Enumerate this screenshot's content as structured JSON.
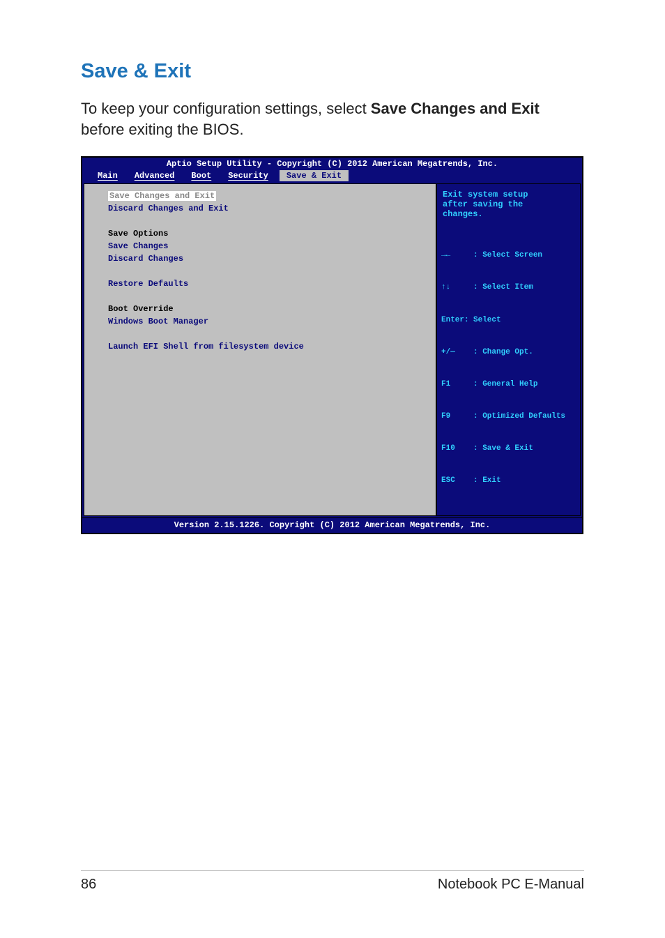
{
  "heading": "Save & Exit",
  "intro_before": "To keep your configuration settings, select ",
  "intro_bold": "Save Changes and Exit",
  "intro_after": " before exiting the BIOS.",
  "bios": {
    "title": "Aptio Setup Utility - Copyright (C) 2012 American Megatrends, Inc.",
    "tabs": {
      "main": "Main",
      "advanced": "Advanced",
      "boot": "Boot",
      "security": "Security",
      "save_exit": "Save & Exit"
    },
    "left": {
      "save_changes_exit": "Save Changes and Exit",
      "discard_changes_exit": "Discard Changes and Exit",
      "save_options_heading": "Save Options",
      "save_changes": "Save Changes",
      "discard_changes": "Discard Changes",
      "restore_defaults": "Restore Defaults",
      "boot_override_heading": "Boot Override",
      "windows_boot_manager": "Windows Boot Manager",
      "launch_efi_shell": "Launch EFI Shell from filesystem device"
    },
    "right": {
      "help_line1": "Exit system setup",
      "help_line2": "after saving the",
      "help_line3": "changes.",
      "keys": {
        "arrows_lr": "→←",
        "arrows_lr_desc": ": Select Screen",
        "arrows_ud": "↑↓",
        "arrows_ud_desc": ": Select Item",
        "enter": "Enter:",
        "enter_desc": "Select",
        "pm": "+/—",
        "pm_desc": ": Change Opt.",
        "f1": "F1",
        "f1_desc": ": General Help",
        "f9": "F9",
        "f9_desc": ": Optimized Defaults",
        "f10": "F10",
        "f10_desc": ": Save & Exit",
        "esc": "ESC",
        "esc_desc": ": Exit"
      }
    },
    "footer": "Version 2.15.1226. Copyright (C) 2012 American Megatrends, Inc."
  },
  "footer": {
    "page": "86",
    "title": "Notebook PC E-Manual"
  }
}
